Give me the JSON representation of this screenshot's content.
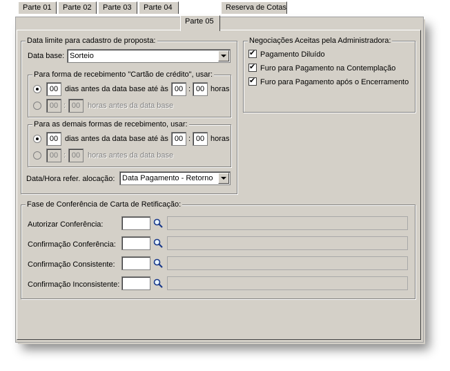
{
  "tabs": [
    "Parte 01",
    "Parte 02",
    "Parte 03",
    "Parte 04",
    "Parte 05",
    "Reserva de Cotas"
  ],
  "active_tab": "Parte 05",
  "data_limite": {
    "legend": "Data limite para cadastro de proposta:",
    "data_base_label": "Data base:",
    "data_base_value": "Sorteio",
    "cartao": {
      "legend": "Para forma de recebimento \"Cartão de crédito\", usar:",
      "row1": {
        "days": "00",
        "text1": "dias antes da data base até às",
        "hh": "00",
        "sep": ":",
        "mm": "00",
        "text2": "horas"
      },
      "row2": {
        "a": "00",
        "sep": ":",
        "b": "00",
        "text": "horas antes da data base"
      }
    },
    "demais": {
      "legend": "Para as demais formas de recebimento, usar:",
      "row1": {
        "days": "00",
        "text1": "dias antes da data base até às",
        "hh": "00",
        "sep": ":",
        "mm": "00",
        "text2": "horas"
      },
      "row2": {
        "a": "00",
        "sep": ":",
        "b": "00",
        "text": "horas antes da data base"
      }
    },
    "alocacao_label": "Data/Hora refer. alocação:",
    "alocacao_value": "Data Pagamento - Retorno"
  },
  "negociacoes": {
    "legend": "Negociações Aceitas pela Administradora:",
    "items": [
      {
        "label": "Pagamento Diluído",
        "checked": true
      },
      {
        "label": "Furo para Pagamento na Contemplação",
        "checked": true
      },
      {
        "label": "Furo para Pagamento após o Encerramento",
        "checked": true
      }
    ]
  },
  "fase": {
    "legend": "Fase de Conferência de Carta de Retificação:",
    "rows": [
      {
        "label": "Autorizar Conferência:"
      },
      {
        "label": "Confirmação Conferência:"
      },
      {
        "label": "Confirmação Consistente:"
      },
      {
        "label": "Confirmação Inconsistente:"
      }
    ]
  }
}
